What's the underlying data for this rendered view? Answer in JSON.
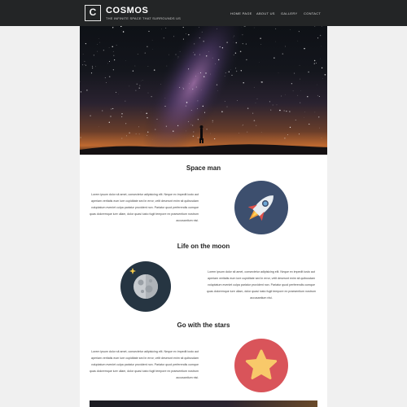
{
  "header": {
    "logo_letter": "C",
    "title": "COSMOS",
    "tagline": "THE INFINITE SPACE THAT SURROUNDS US",
    "nav": [
      {
        "label": "HOME PAGE"
      },
      {
        "label": "ABOUT US"
      },
      {
        "label": "GALLERY"
      },
      {
        "label": "CONTACT"
      }
    ]
  },
  "sections": [
    {
      "title": "Space man",
      "paragraph": "Lorem ipsum dolor sit amet, consectetur adipisicing elit. Neque ex impedit iusto aut aperiam veritatis eum iure cupiditate sed in error, velit deserunt enim sit quibusdam voluptatum eveniet culpa pariatur provident non. Pariatur quod perferendis cumque quas doloremque iure ullam, dolor quasi iusto fugit tempore ex praesentium nostrum accusantium nisi.",
      "icon": "rocket-icon",
      "circle_color": "#3d4f6e"
    },
    {
      "title": "Life on the moon",
      "paragraph": "Lorem ipsum dolor sit amet, consectetur adipisicing elit. Neque ex impedit iusto aut aperiam veritatis eum iure cupiditate sed in error, velit deserunt enim sit quibusdam voluptatum eveniet culpa pariatur provident non. Pariatur quod perferendis cumque quas doloremque iure ullam, dolor quasi iusto fugit tempore ex praesentium nostrum accusantium nisi.",
      "icon": "moon-icon",
      "circle_color": "#263542"
    },
    {
      "title": "Go with the stars",
      "paragraph": "Lorem ipsum dolor sit amet, consectetur adipisicing elit. Neque ex impedit iusto aut aperiam veritatis eum iure cupiditate sed in error, velit deserunt enim sit quibusdam voluptatum eveniet culpa pariatur provident non. Pariatur quod perferendis cumque quas doloremque iure ullam, dolor quasi iusto fugit tempore ex praesentium nostrum accusantium nisi.",
      "icon": "star-icon",
      "circle_color": "#d9545a"
    }
  ],
  "colors": {
    "topbar": "#232526",
    "page_background": "#f0f0f0",
    "content_background": "#ffffff"
  }
}
